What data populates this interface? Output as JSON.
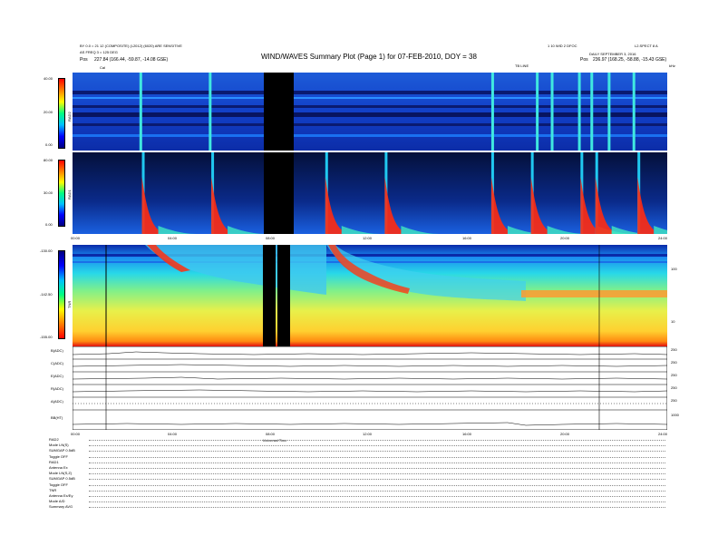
{
  "header": {
    "left_line1": "BY 0.0 = 21 12 (COMPOSITE) (L2012) (6020) ARE SENSITIVE",
    "left_line2": "AS FREQ 3 = 125 DEG",
    "left_pos_label": "Pos",
    "left_pos_value": "227.84 (166.44, -59.87, -14.08 GSE)",
    "right_line1": "1 10 WID 2 DFOC",
    "right_line1b": "L2.SPECT 8 A",
    "right_line2": "DAILY SEPTEMBER 3, 2016",
    "right_pos_label": "Pos",
    "right_pos_value": "236.97 (168.25, -58.88, -15.43 GSE)",
    "title": "WIND/WAVES Summary Plot (Page 1) for 07-FEB-2010, DOY = 38",
    "cal_label": "Cal",
    "tbline": "TB LINE",
    "mhz": "kHz"
  },
  "chart_data": [
    {
      "type": "heatmap",
      "title": "RAD2",
      "ylabel": "RAD2",
      "yticks": [
        "40.00",
        "20.00",
        "0.00"
      ],
      "ylim": [
        0,
        40
      ],
      "colorbar_stops": [
        "#000080",
        "#0000ff",
        "#00c0ff",
        "#00ff80",
        "#ffff00",
        "#ff8000",
        "#ff0000"
      ],
      "bursts_hours": [
        2.7,
        5.5,
        16.9,
        18.7,
        19.3,
        20.4,
        20.9,
        21.6,
        22.6
      ]
    },
    {
      "type": "heatmap",
      "title": "RAD1",
      "ylabel": "RAD1",
      "yticks": [
        "80.00",
        "30.00",
        "0.00"
      ],
      "ylim": [
        0,
        80
      ],
      "xticks": [
        "00:00",
        "04:00",
        "08:00",
        "12:00",
        "16:00",
        "20:00",
        "24:00"
      ],
      "data_gap_hours": [
        7.9,
        8.9
      ],
      "bursts_hours": [
        2.8,
        5.6,
        10.2,
        12.6,
        16.9,
        18.5,
        20.5,
        21.1,
        22.8
      ]
    },
    {
      "type": "heatmap",
      "title": "TNR",
      "ylabel": "TNR",
      "yticks": [
        "-130.00",
        "-142.50",
        "-155.00"
      ],
      "ylim": [
        -155,
        -130
      ],
      "right_ticks": [
        "100",
        "10"
      ],
      "data_gap_hours": [
        7.6,
        8.9
      ]
    },
    {
      "type": "line",
      "title": "Parameters",
      "series": [
        {
          "name": "B(ADC)",
          "right_ticks": [
            "250",
            "200"
          ]
        },
        {
          "name": "C(ADC)",
          "right_ticks": [
            "250",
            "200"
          ]
        },
        {
          "name": "E(ADC)",
          "right_ticks": [
            "250",
            "200"
          ]
        },
        {
          "name": "R(ADC)",
          "right_ticks": [
            "250",
            "200"
          ]
        },
        {
          "name": "A(ADC)",
          "right_ticks": [
            "250",
            "200"
          ]
        },
        {
          "name": "BB(HT)",
          "right_ticks": [
            "1000",
            "100"
          ]
        }
      ],
      "xticks": [
        "00:00",
        "04:00",
        "08:00",
        "12:00",
        "16:00",
        "20:00",
        "24:00"
      ],
      "xlabel": "Universal Time"
    }
  ],
  "footer": [
    {
      "label": "RAD2",
      "value": ""
    },
    {
      "label": "Mode",
      "value": "LN(S)"
    },
    {
      "label": "SUMGAP",
      "value": "0.5dB"
    },
    {
      "label": "Toggle",
      "value": "OFF"
    },
    {
      "label": "RAD1",
      "value": ""
    },
    {
      "label": "Antenna",
      "value": "Ex"
    },
    {
      "label": "Mode",
      "value": "LN(S,Z)"
    },
    {
      "label": "SUMGAP",
      "value": "0.5dB"
    },
    {
      "label": "Toggle",
      "value": "OFF"
    },
    {
      "label": "TNR",
      "value": ""
    },
    {
      "label": "Antenna",
      "value": "Ex/Ey"
    },
    {
      "label": "Mode",
      "value": "A/D"
    },
    {
      "label": "Summary",
      "value": "AVG"
    }
  ]
}
